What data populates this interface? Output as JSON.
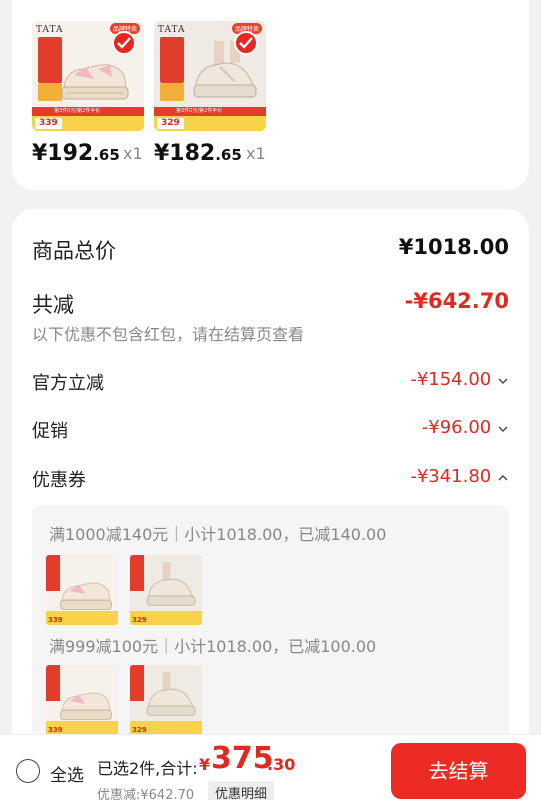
{
  "selected_items": [
    {
      "brand": "TATA",
      "top_badge": "品牌特卖",
      "promo_strip": "第3件0元/第2件半价",
      "promo_price": "339",
      "price_main": "¥192",
      "price_decimal": ".65",
      "qty": "x1"
    },
    {
      "brand": "TATA",
      "top_badge": "品牌特卖",
      "promo_strip": "第3件0元/第2件半价",
      "promo_price": "329",
      "price_main": "¥182",
      "price_decimal": ".65",
      "qty": "x1"
    }
  ],
  "summary": {
    "total_label": "商品总价",
    "total_value": "¥1018.00",
    "discount_label": "共减",
    "discount_value": "-¥642.70",
    "discount_note": "以下优惠不包含红包，请在结算页查看",
    "rows": [
      {
        "label": "官方立减",
        "value": "-¥154.00",
        "chevron": "chevron-down-icon"
      },
      {
        "label": "促销",
        "value": "-¥96.00",
        "chevron": "chevron-down-icon"
      },
      {
        "label": "优惠券",
        "value": "-¥341.80",
        "chevron": "chevron-up-icon"
      }
    ]
  },
  "coupons": [
    {
      "text": "满1000减140元｜小计1018.00，已减140.00",
      "thumb_prices": [
        "339",
        "329"
      ]
    },
    {
      "text": "满999减100元｜小计1018.00，已减100.00",
      "thumb_prices": [
        "339",
        "329"
      ]
    }
  ],
  "bottom_bar": {
    "select_all": "全选",
    "selected_text": "已选2件,合计:",
    "currency": "¥",
    "total_main": "375",
    "total_decimal": ".30",
    "saving_text": "优惠减:¥642.70",
    "detail_button": "优惠明细",
    "checkout_button": "去结算"
  },
  "colors": {
    "accent": "#ec2b25",
    "discount_text": "#e0291f",
    "muted": "#888888"
  }
}
